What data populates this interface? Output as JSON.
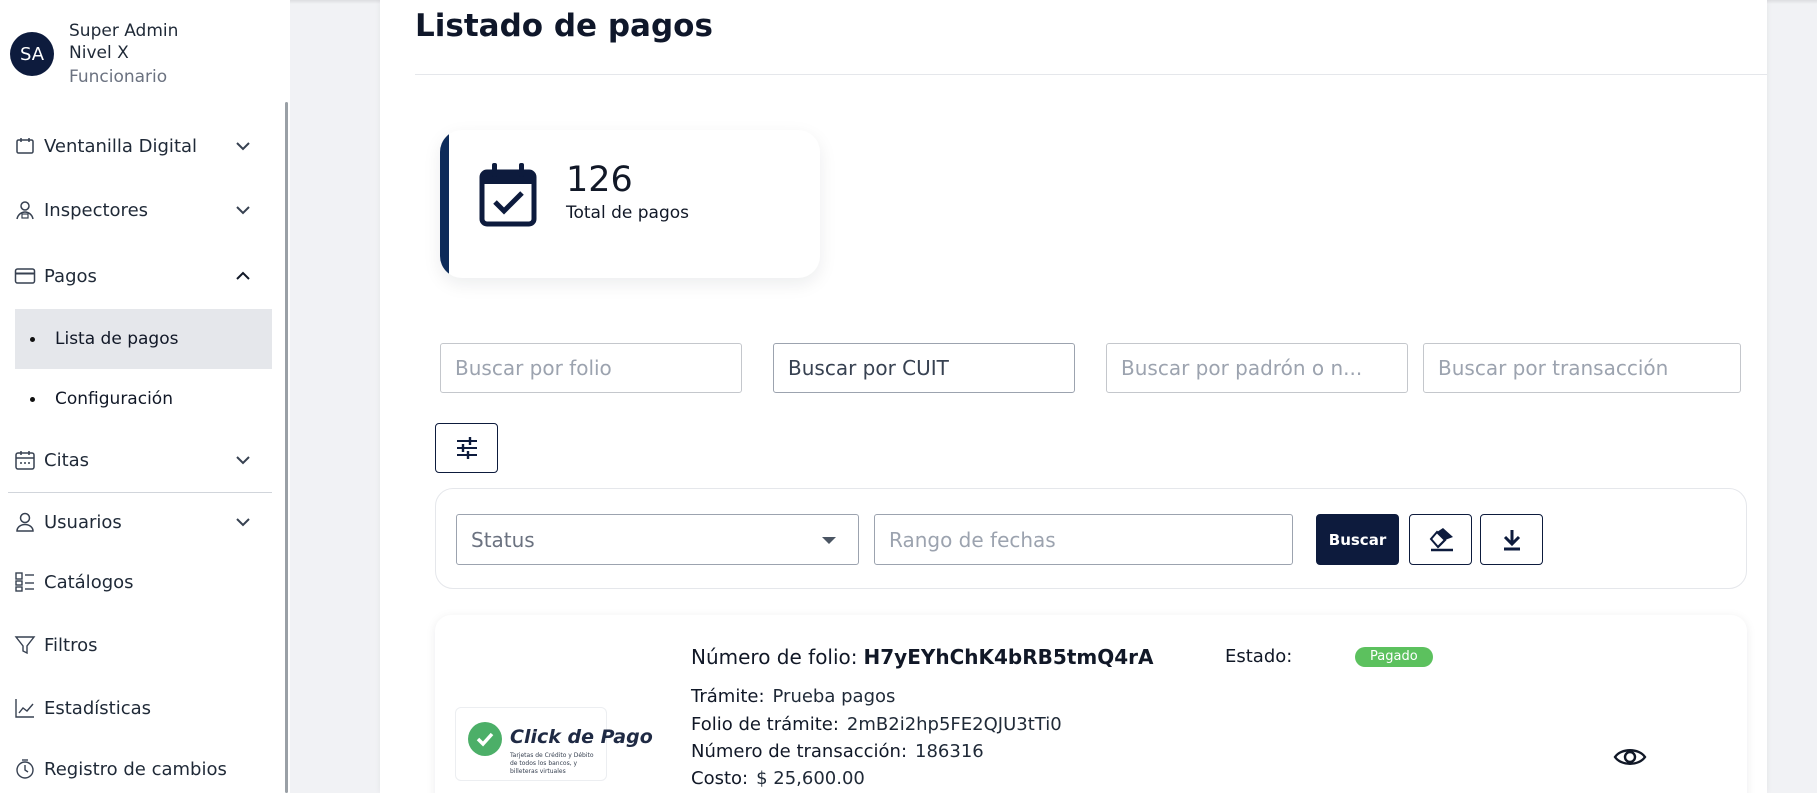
{
  "user": {
    "initials": "SA",
    "name": "Super Admin",
    "level": "Nivel X",
    "role": "Funcionario"
  },
  "sidebar": {
    "items": [
      {
        "label": "Ventanilla Digital",
        "icon": "window-icon"
      },
      {
        "label": "Inspectores",
        "icon": "inspector-icon"
      },
      {
        "label": "Pagos",
        "icon": "credit-card-icon"
      },
      {
        "label": "Citas",
        "icon": "calendar-icon"
      },
      {
        "label": "Usuarios",
        "icon": "user-icon"
      },
      {
        "label": "Catálogos",
        "icon": "catalog-icon"
      },
      {
        "label": "Filtros",
        "icon": "filter-icon"
      },
      {
        "label": "Estadísticas",
        "icon": "chart-icon"
      },
      {
        "label": "Registro de cambios",
        "icon": "history-icon"
      }
    ],
    "pagos_subitems": [
      {
        "label": "Lista de pagos",
        "active": true
      },
      {
        "label": "Configuración",
        "active": false
      }
    ]
  },
  "main": {
    "title": "Listado de pagos",
    "stat": {
      "value": "126",
      "label": "Total de pagos"
    },
    "search": {
      "folio_placeholder": "Buscar por folio",
      "cuit_value": "Buscar por CUIT",
      "padron_placeholder": "Buscar por padrón o n...",
      "transaccion_placeholder": "Buscar por transacción"
    },
    "filters": {
      "status_label": "Status",
      "range_placeholder": "Rango de fechas",
      "search_button": "Buscar"
    },
    "payment": {
      "folio_label": "Número de folio:",
      "folio_value": "H7yEYhChK4bRB5tmQ4rA",
      "estado_label": "Estado:",
      "estado_value": "Pagado",
      "tramite_label": "Trámite:",
      "tramite_value": "Prueba pagos",
      "folio_tramite_label": "Folio de trámite:",
      "folio_tramite_value": "2mB2i2hp5FE2QJU3tTi0",
      "transaccion_label": "Número de transacción:",
      "transaccion_value": "186316",
      "costo_label": "Costo:",
      "costo_value": "$ 25,600.00",
      "logo_title": "Click de Pago",
      "logo_subtitle": "Tarjetas de Crédito y Débito de todos los bancos, y billeteras virtuales"
    }
  },
  "colors": {
    "primary": "#0d1b3d",
    "accent_bar": "#0d2b5a",
    "badge_paid": "#5cc15e",
    "active_bg": "#e5e7eb"
  }
}
